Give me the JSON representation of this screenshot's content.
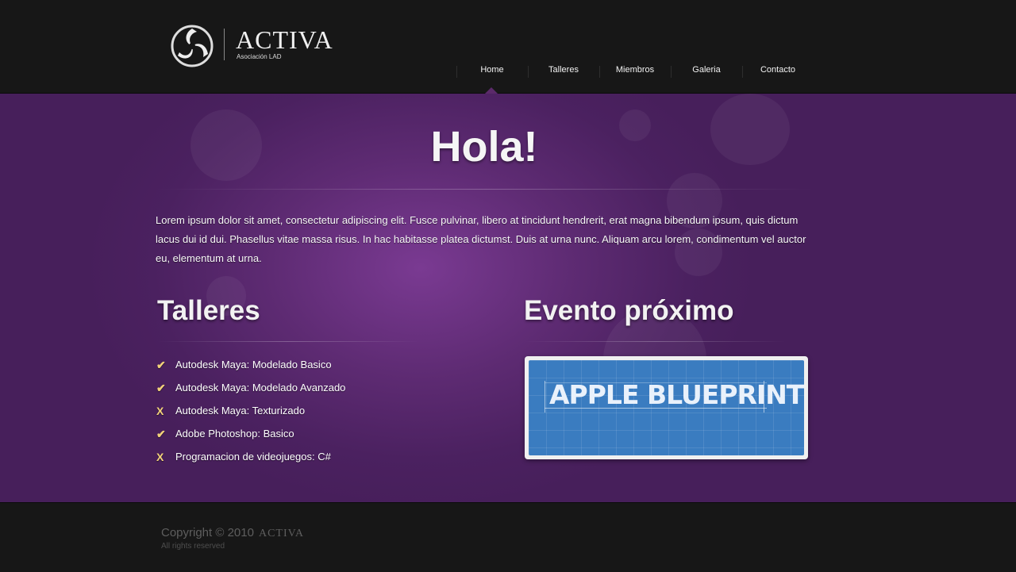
{
  "header": {
    "logo_name": "ACTIVA",
    "logo_subtitle": "Asociación LAD"
  },
  "nav": {
    "items": [
      "Home",
      "Talleres",
      "Miembros",
      "Galeria",
      "Contacto"
    ],
    "active": "Home"
  },
  "hero": {
    "title": "Hola!",
    "intro": "Lorem ipsum dolor sit amet, consectetur adipiscing elit. Fusce pulvinar, libero at tincidunt hendrerit, erat magna bibendum ipsum, quis dictum lacus dui id dui. Phasellus vitae massa risus. In hac habitasse platea dictumst. Duis at urna nunc. Aliquam arcu lorem, condimentum vel auctor eu, elementum at urna."
  },
  "workshops": {
    "title": "Talleres",
    "items": [
      {
        "label": "Autodesk Maya: Modelado Basico",
        "status": "check"
      },
      {
        "label": "Autodesk Maya: Modelado Avanzado",
        "status": "check"
      },
      {
        "label": "Autodesk Maya: Texturizado",
        "status": "x"
      },
      {
        "label": "Adobe Photoshop: Basico",
        "status": "check"
      },
      {
        "label": "Programacion de videojuegos: C#",
        "status": "x"
      }
    ]
  },
  "event": {
    "title": "Evento próximo",
    "banner_text": "APPLE BLUEPRINT"
  },
  "footer": {
    "copyright": "Copyright © 2010",
    "brand": "ACTIVA",
    "rights": "All rights reserved"
  },
  "colors": {
    "background": "#171717",
    "purple": "#5e2b73",
    "accent_mark": "#f2d27a",
    "blueprint": "#3a7cc0"
  }
}
